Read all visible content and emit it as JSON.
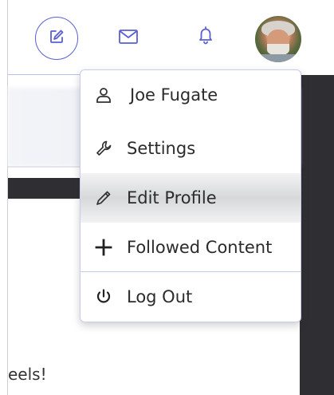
{
  "nav": {
    "icons": {
      "compose": "compose-icon",
      "mail": "mail-icon",
      "bell": "bell-icon",
      "avatar": "user-avatar"
    },
    "accent_color": "#5b5fd6"
  },
  "background": {
    "post_text": "eels!"
  },
  "dropdown": {
    "items": [
      {
        "label": "Joe Fugate",
        "icon": "user-icon"
      },
      {
        "label": "Settings",
        "icon": "wrench-icon"
      },
      {
        "label": "Edit Profile",
        "icon": "pencil-icon"
      },
      {
        "label": "Followed Content",
        "icon": "plus-icon"
      },
      {
        "label": "Log Out",
        "icon": "power-icon"
      }
    ],
    "hover_item": "Edit Profile"
  }
}
